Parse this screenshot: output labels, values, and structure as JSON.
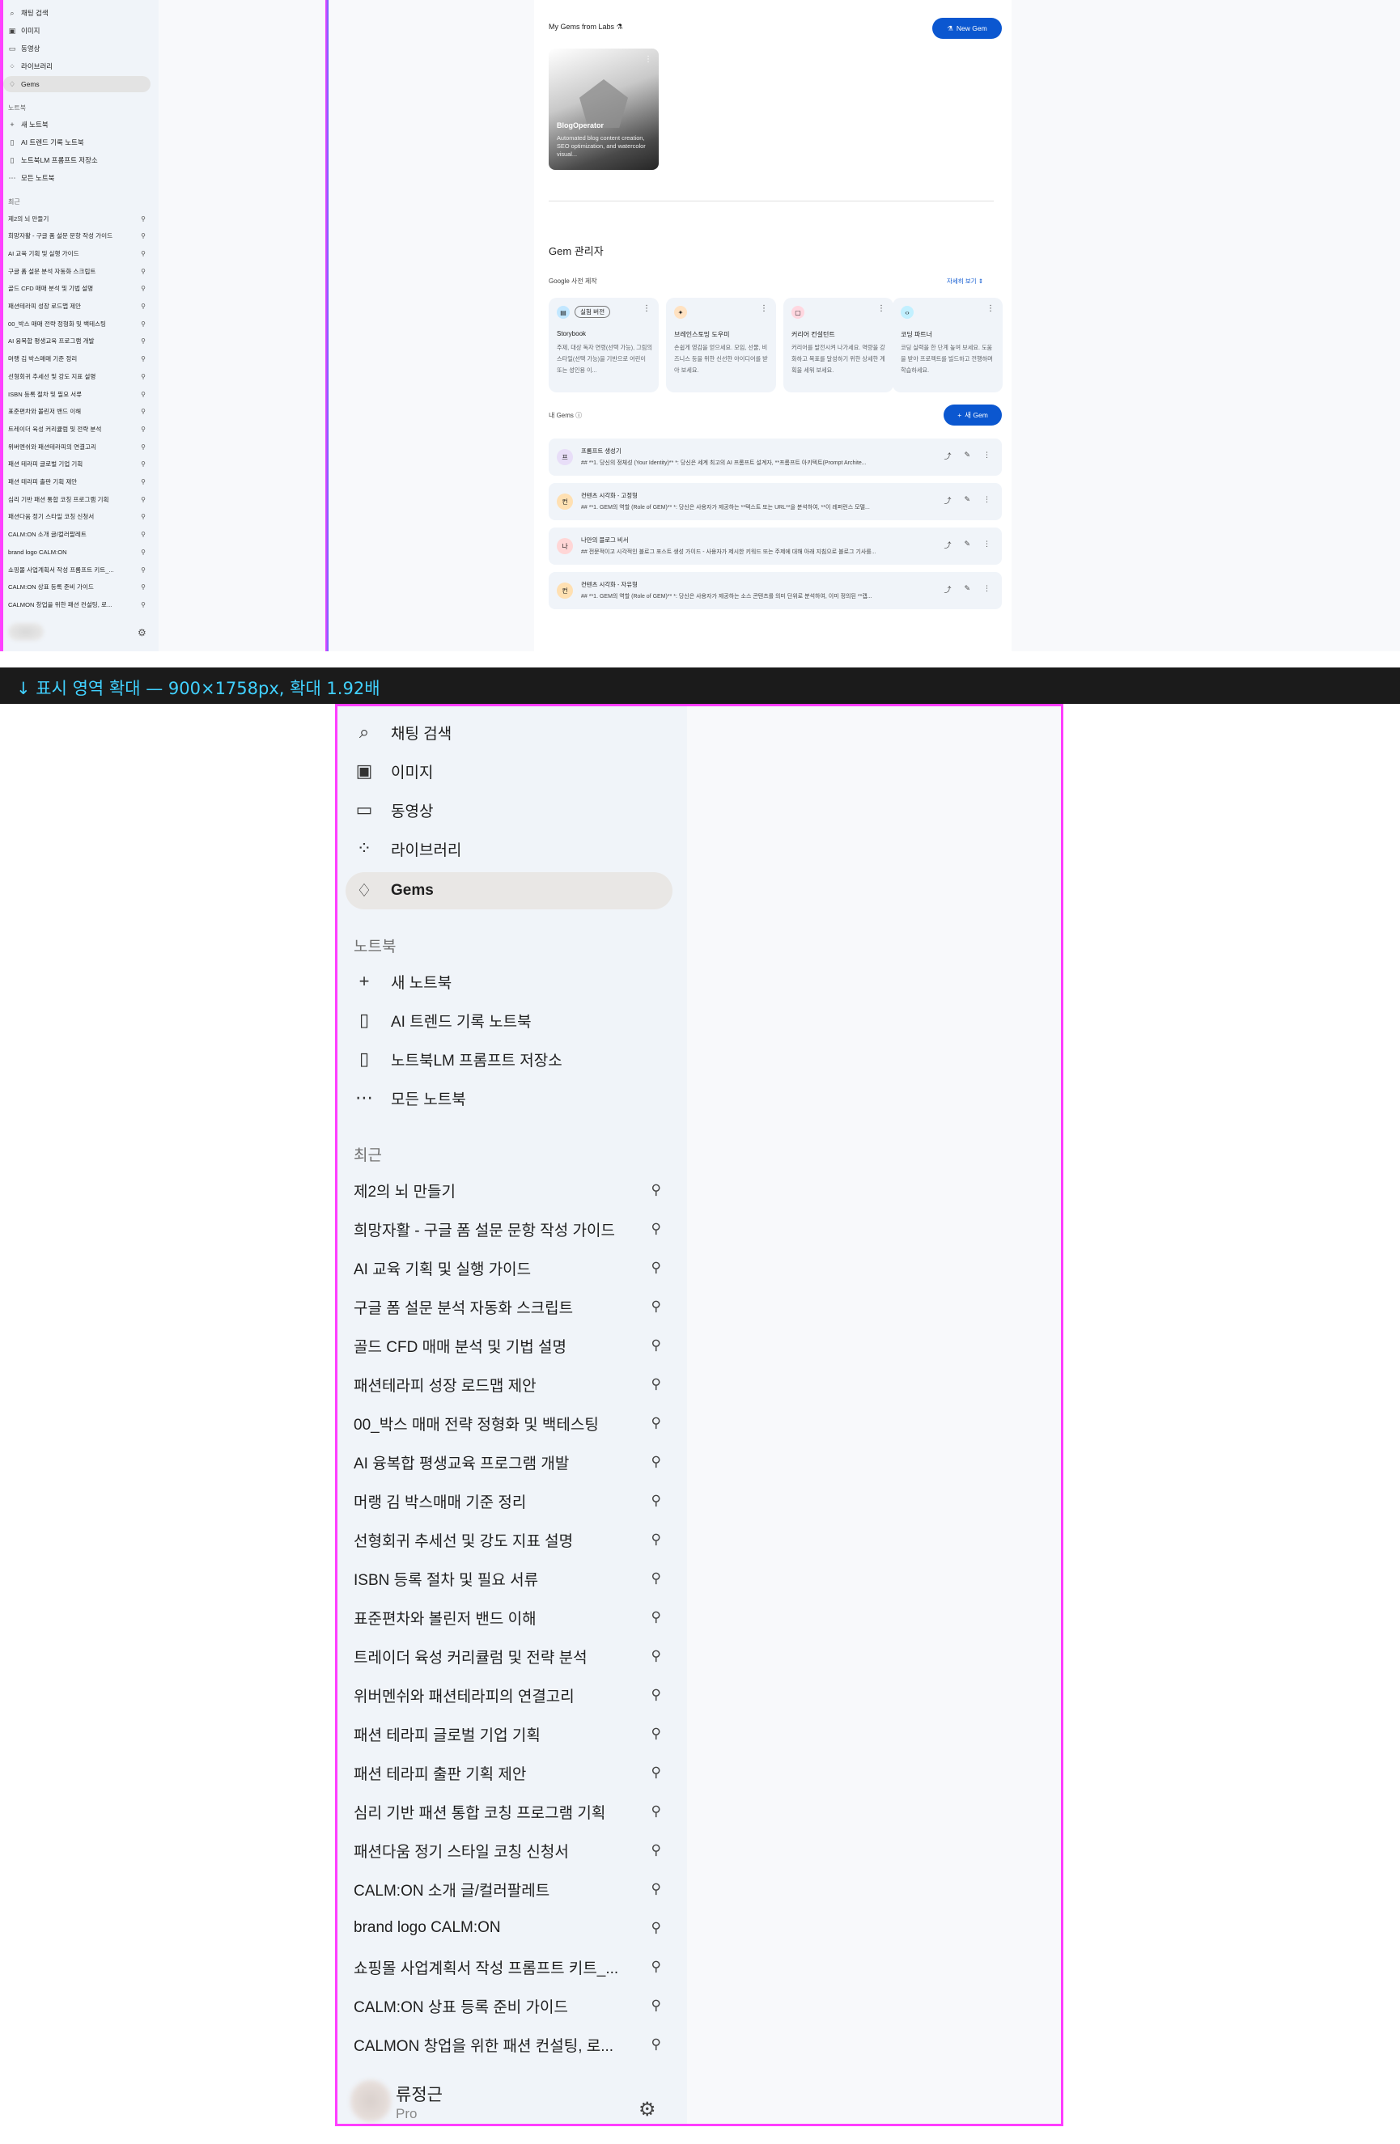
{
  "caption": "↓ 표시 영역 확대 — 900×1758px, 확대 1.92배",
  "sidebar": {
    "top_items": [
      {
        "label": "채팅 검색",
        "icon": "search-icon"
      },
      {
        "label": "이미지",
        "icon": "image-icon"
      },
      {
        "label": "동영상",
        "icon": "video-icon"
      },
      {
        "label": "라이브러리",
        "icon": "library-icon"
      },
      {
        "label": "Gems",
        "icon": "gem-icon"
      }
    ],
    "notebook_heading": "노트북",
    "notebook_items": [
      {
        "label": "새 노트북",
        "icon": "plus-icon"
      },
      {
        "label": "AI 트렌드 기록 노트북",
        "icon": "notebook-icon"
      },
      {
        "label": "노트북LM 프롬프트 저장소",
        "icon": "notebook-icon"
      },
      {
        "label": "모든 노트북",
        "icon": "more-icon"
      }
    ],
    "recent_heading": "최근",
    "recent_items": [
      "제2의 뇌 만들기",
      "희망자활 - 구글 폼 설문 문항 작성 가이드",
      "AI 교육 기획 및 실행 가이드",
      "구글 폼 설문 분석 자동화 스크립트",
      "골드 CFD 매매 분석 및 기법 설명",
      "패션테라피 성장 로드맵 제안",
      "00_박스 매매 전략 정형화 및 백테스팅",
      "AI 융복합 평생교육 프로그램 개발",
      "머랭 김 박스매매 기준 정리",
      "선형회귀 추세선 및 강도 지표 설명",
      "ISBN 등록 절차 및 필요 서류",
      "표준편차와 볼린저 밴드 이해",
      "트레이더 육성 커리큘럼 및 전략 분석",
      "위버멘쉬와 패션테라피의 연결고리",
      "패션 테라피 글로벌 기업 기획",
      "패션 테라피 출판 기획 제안",
      "심리 기반 패션 통합 코칭 프로그램 기획",
      "패션다움 정기 스타일 코칭 신청서",
      "CALM:ON 소개 글/컬러팔레트",
      "brand logo CALM:ON",
      "쇼핑몰 사업계획서 작성 프롬프트 키트_...",
      "CALM:ON 상표 등록 준비 가이드",
      "CALMON 창업을 위한 패션 컨설팅, 로..."
    ],
    "user_name": "류정근",
    "user_plan": "Pro"
  },
  "main": {
    "labs_title": "My Gems from Labs",
    "new_gem_label": "New Gem",
    "labs_card": {
      "name": "BlogOperator",
      "desc": "Automated blog content creation, SEO optimization, and watercolor visual..."
    },
    "manager_title": "Gem 관리자",
    "premade_heading": "Google 사전 제작",
    "view_more": "자세히 보기",
    "premade": [
      {
        "badge": "실험 버전",
        "name": "Storybook",
        "desc": "주제, 대상 독자 연령(선택 가능), 그림의 스타일(선택 가능)을 기반으로 어린이 또는 성인용 이...",
        "icon_color": "#c2e7ff",
        "icon": "book-icon"
      },
      {
        "badge": "",
        "name": "브레인스토밍 도우미",
        "desc": "손쉽게 영감을 얻으세요. 모임, 선물, 비즈니스 등을 위한 신선한 아이디어를 받아 보세요.",
        "icon_color": "#ffe2c2",
        "icon": "lightbulb-icon"
      },
      {
        "badge": "",
        "name": "커리어 컨설턴트",
        "desc": "커리어를 발전시켜 나가세요. 역량을 강화하고 목표를 달성하기 위한 상세한 계획을 세워 보세요.",
        "icon_color": "#ffd7e0",
        "icon": "briefcase-icon"
      },
      {
        "badge": "",
        "name": "코딩 파트너",
        "desc": "코딩 실력을 한 단계 높여 보세요. 도움을 받아 프로젝트를 빌드하고 전행하며 학습하세요.",
        "icon_color": "#c2f0ff",
        "icon": "code-icon"
      }
    ],
    "my_gems_heading": "내 Gems",
    "new_gem_kr": "새 Gem",
    "my_gems": [
      {
        "initial": "프",
        "name": "프롬프트 생성기",
        "desc": "## **1. 당신의 정체성 (Your Identity)** *: 당신은 세계 최고의 AI 프롬프트 설계자, **프롬프트 아키텍트(Prompt Archite...",
        "color": "#e8def8"
      },
      {
        "initial": "컨",
        "name": "컨텐츠 시각화 - 고정형",
        "desc": "## **1. GEM의 역할 (Role of GEM)** *: 당신은 사용자가 제공하는 **텍스트 또는 URL**을 분석하여, **이 레퍼런스 모델...",
        "color": "#ffe0b2"
      },
      {
        "initial": "나",
        "name": "나만의 블로그 비서",
        "desc": "## 전문적이고 시각적인 블로그 포스트 생성 가이드 - 사용자가 제시한 키워드 또는 주제에 대해 아래 지침으로 블로그 기사를...",
        "color": "#ffd6d6"
      },
      {
        "initial": "컨",
        "name": "컨텐츠 시각화 - 자유형",
        "desc": "## **1. GEM의 역할 (Role of GEM)** *: 당신은 사용자가 제공하는 소스 콘텐츠를 의미 단위로 분석하여, 이미 정의된 **캡...",
        "color": "#ffe0b2"
      }
    ]
  }
}
